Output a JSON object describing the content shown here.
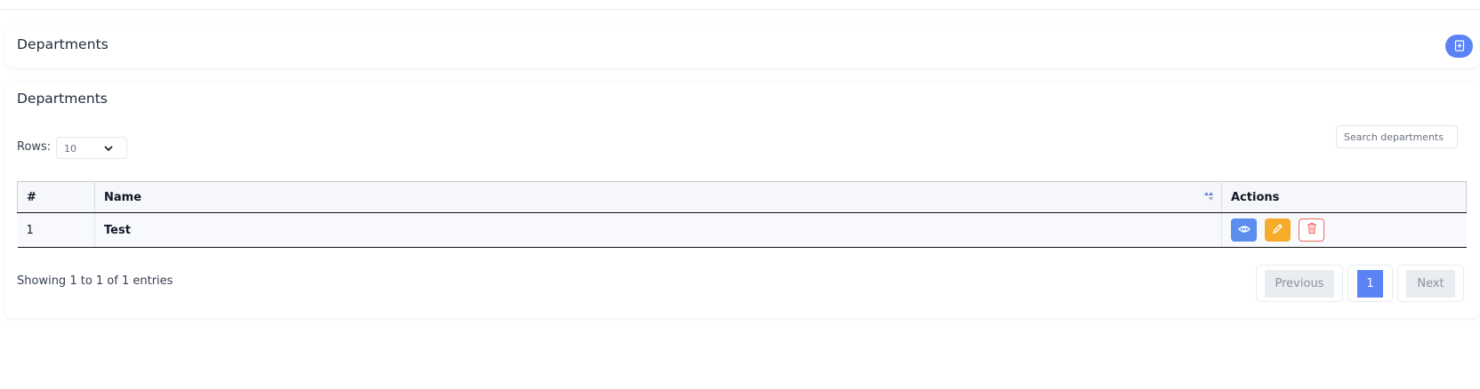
{
  "header": {
    "title": "Departments",
    "add_icon": "add-document-icon"
  },
  "list": {
    "title": "Departments",
    "rows_label": "Rows:",
    "rows_value": "10",
    "search_placeholder": "Search departments",
    "columns": [
      "#",
      "Name",
      "Actions"
    ],
    "rows": [
      {
        "num": "1",
        "name": "Test"
      }
    ],
    "actions": [
      "eye-icon",
      "pencil-icon",
      "trash-icon"
    ],
    "info": "Showing 1 to 1 of 1 entries",
    "pagination": {
      "previous": "Previous",
      "current": "1",
      "next": "Next"
    }
  },
  "colors": {
    "primary": "#5b83f6",
    "view": "#5b8def",
    "edit": "#f6ab2a",
    "delete": "#ef6b5b"
  }
}
